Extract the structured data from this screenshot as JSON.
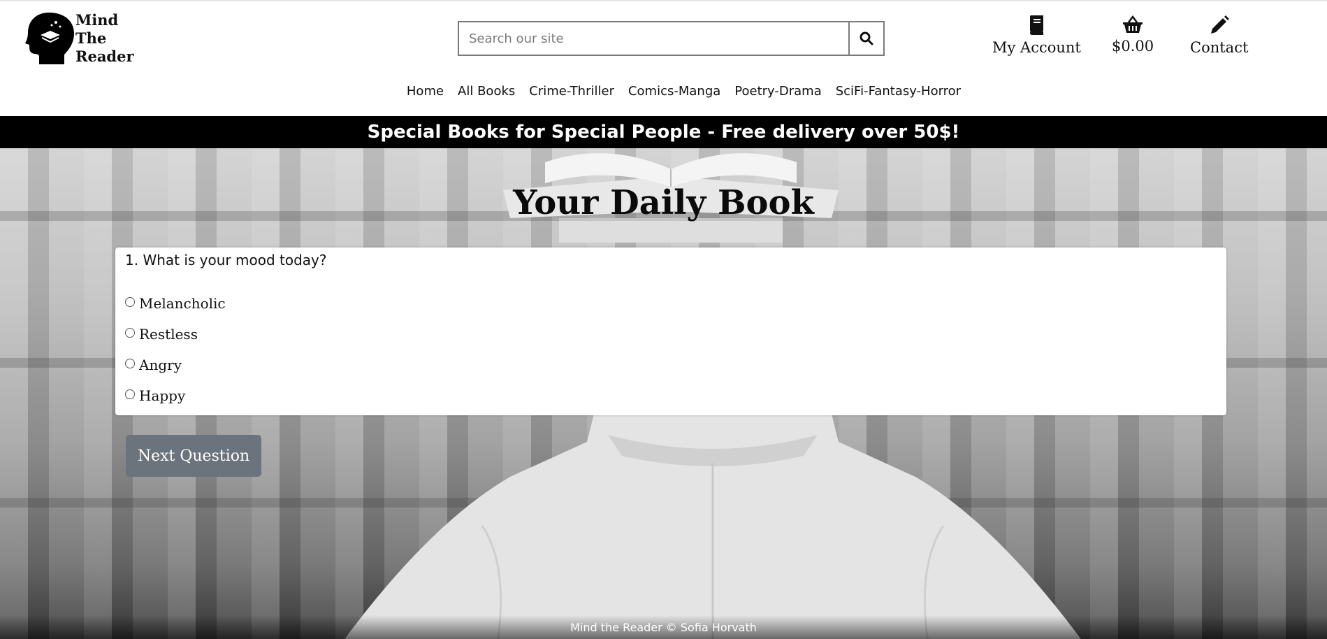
{
  "header": {
    "logo_lines": [
      "Mind",
      "The",
      "Reader"
    ],
    "search_placeholder": "Search our site",
    "account_label": "My Account",
    "basket_label": "$0.00",
    "contact_label": "Contact",
    "icons": {
      "search": "search-icon",
      "account": "book-icon",
      "basket": "basket-icon",
      "contact": "pencil-icon"
    }
  },
  "nav": {
    "items": [
      "Home",
      "All Books",
      "Crime-Thriller",
      "Comics-Manga",
      "Poetry-Drama",
      "SciFi-Fantasy-Horror"
    ]
  },
  "banner": {
    "text": "Special Books for Special People - Free delivery over 50$!"
  },
  "main": {
    "title": "Your Daily Book",
    "question": "1. What is your mood today?",
    "options": [
      "Melancholic",
      "Restless",
      "Angry",
      "Happy"
    ],
    "next_button": "Next Question"
  },
  "footer": {
    "text": "Mind the Reader © Sofia Horvath"
  },
  "colors": {
    "banner_bg": "#000000",
    "button_bg": "#6b747c"
  }
}
